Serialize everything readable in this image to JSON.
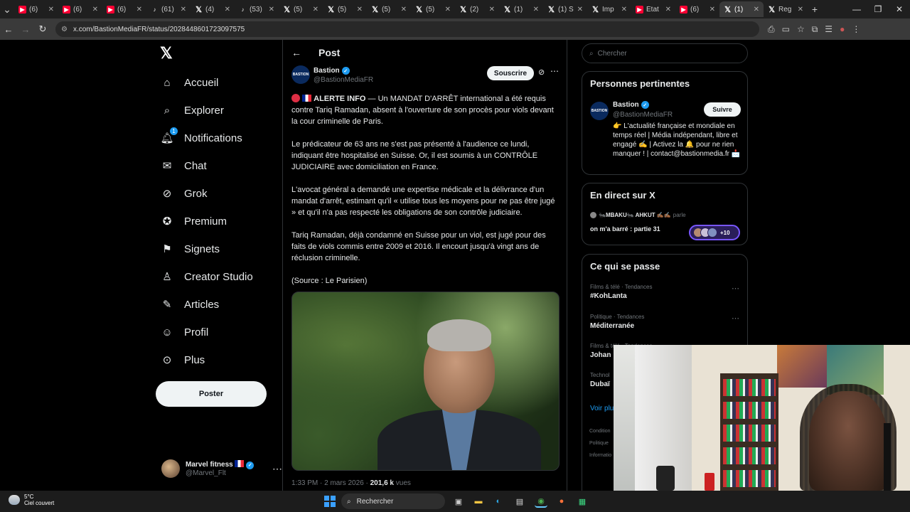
{
  "browser": {
    "tabs": [
      {
        "icon": "youtube",
        "label": "(6) "
      },
      {
        "icon": "youtube",
        "label": "(6) "
      },
      {
        "icon": "youtube",
        "label": "(6) "
      },
      {
        "icon": "tiktok",
        "label": "(61) "
      },
      {
        "icon": "x",
        "label": "(4) "
      },
      {
        "icon": "tiktok",
        "label": "(53) "
      },
      {
        "icon": "x",
        "label": "(5) "
      },
      {
        "icon": "x",
        "label": "(5) "
      },
      {
        "icon": "x",
        "label": "(5) "
      },
      {
        "icon": "x",
        "label": "(5) "
      },
      {
        "icon": "x",
        "label": "(2) "
      },
      {
        "icon": "x",
        "label": "(1) "
      },
      {
        "icon": "x",
        "label": "(1) S"
      },
      {
        "icon": "x",
        "label": "Imp"
      },
      {
        "icon": "youtube",
        "label": "État"
      },
      {
        "icon": "youtube",
        "label": "(6) "
      },
      {
        "icon": "x",
        "label": "(1) "
      },
      {
        "icon": "x",
        "label": "Reg"
      }
    ],
    "url": "x.com/BastionMediaFR/status/2028448601723097575"
  },
  "nav": {
    "items": [
      {
        "label": "Accueil",
        "icon": "home-icon"
      },
      {
        "label": "Explorer",
        "icon": "search-icon"
      },
      {
        "label": "Notifications",
        "icon": "bell-icon",
        "badge": "1"
      },
      {
        "label": "Chat",
        "icon": "mail-icon"
      },
      {
        "label": "Grok",
        "icon": "grok-icon"
      },
      {
        "label": "Premium",
        "icon": "premium-icon"
      },
      {
        "label": "Signets",
        "icon": "bookmark-icon"
      },
      {
        "label": "Creator Studio",
        "icon": "creator-icon"
      },
      {
        "label": "Articles",
        "icon": "articles-icon"
      },
      {
        "label": "Profil",
        "icon": "person-icon"
      },
      {
        "label": "Plus",
        "icon": "more-circle-icon"
      }
    ],
    "post_label": "Poster",
    "account": {
      "name": "Marvel fitness",
      "handle": "@Marvel_Flt"
    }
  },
  "main": {
    "header_title": "Post",
    "author": {
      "name": "Bastion",
      "handle": "@BastionMediaFR",
      "avatar_text": "BASTION"
    },
    "subscribe_label": "Souscrire",
    "tweet": {
      "lead_bold": "ALERTE INFO",
      "p1_rest": " — Un MANDAT D'ARRÊT international a été requis contre Tariq Ramadan, absent à l'ouverture de son procès pour viols devant la cour criminelle de Paris.",
      "p2": "Le prédicateur de 63 ans ne s'est pas présenté à l'audience ce lundi, indiquant être hospitalisé en Suisse. Or, il est soumis à un CONTRÔLE JUDICIAIRE avec domiciliation en France.",
      "p3": "L'avocat général a demandé une expertise médicale et la délivrance d'un mandat d'arrêt, estimant qu'il « utilise tous les moyens pour ne pas être jugé » et qu'il n'a pas respecté les obligations de son contrôle judiciaire.",
      "p4": "Tariq Ramadan, déjà condamné en Suisse pour un viol, est jugé pour des faits de viols commis entre 2009 et 2016. Il encourt jusqu'à vingt ans de réclusion criminelle.",
      "p5": "(Source : Le Parisien)"
    },
    "meta": {
      "time": "1:33 PM · 2 mars 2026 · ",
      "views": "201,6 k",
      "views_label": " vues"
    }
  },
  "sidebar": {
    "search_placeholder": "Chercher",
    "relevant": {
      "title": "Personnes pertinentes",
      "name": "Bastion",
      "handle": "@BastionMediaFR",
      "follow_label": "Suivre",
      "bio": "👉 L'actualité française et mondiale en temps réel | Média indépendant, libre et engagé ✍️ | Activez la 🔔 pour ne rien manquer ! | contact@bastionmedia.fr 📩"
    },
    "live": {
      "title": "En direct sur X",
      "hosts": "🐜MBAKU🐜 AHKUT ✍🏾✍🏾",
      "speaking": " parle",
      "space_title": "on m'a barré : partie 31",
      "listeners": "+10"
    },
    "trends": {
      "title": "Ce qui se passe",
      "items": [
        {
          "category": "Films & télé · Tendances",
          "name": "#KohLanta"
        },
        {
          "category": "Politique · Tendances",
          "name": "Méditerranée"
        },
        {
          "category": "Films & télé · Tendances",
          "name": "Johan"
        },
        {
          "category": "Technol",
          "name": "Dubaï"
        }
      ],
      "see_more": "Voir plu",
      "footer": [
        "Condition",
        "Politique",
        "Informatio"
      ]
    }
  },
  "taskbar": {
    "temp": "5°C",
    "weather": "Ciel couvert",
    "search": "Rechercher"
  }
}
